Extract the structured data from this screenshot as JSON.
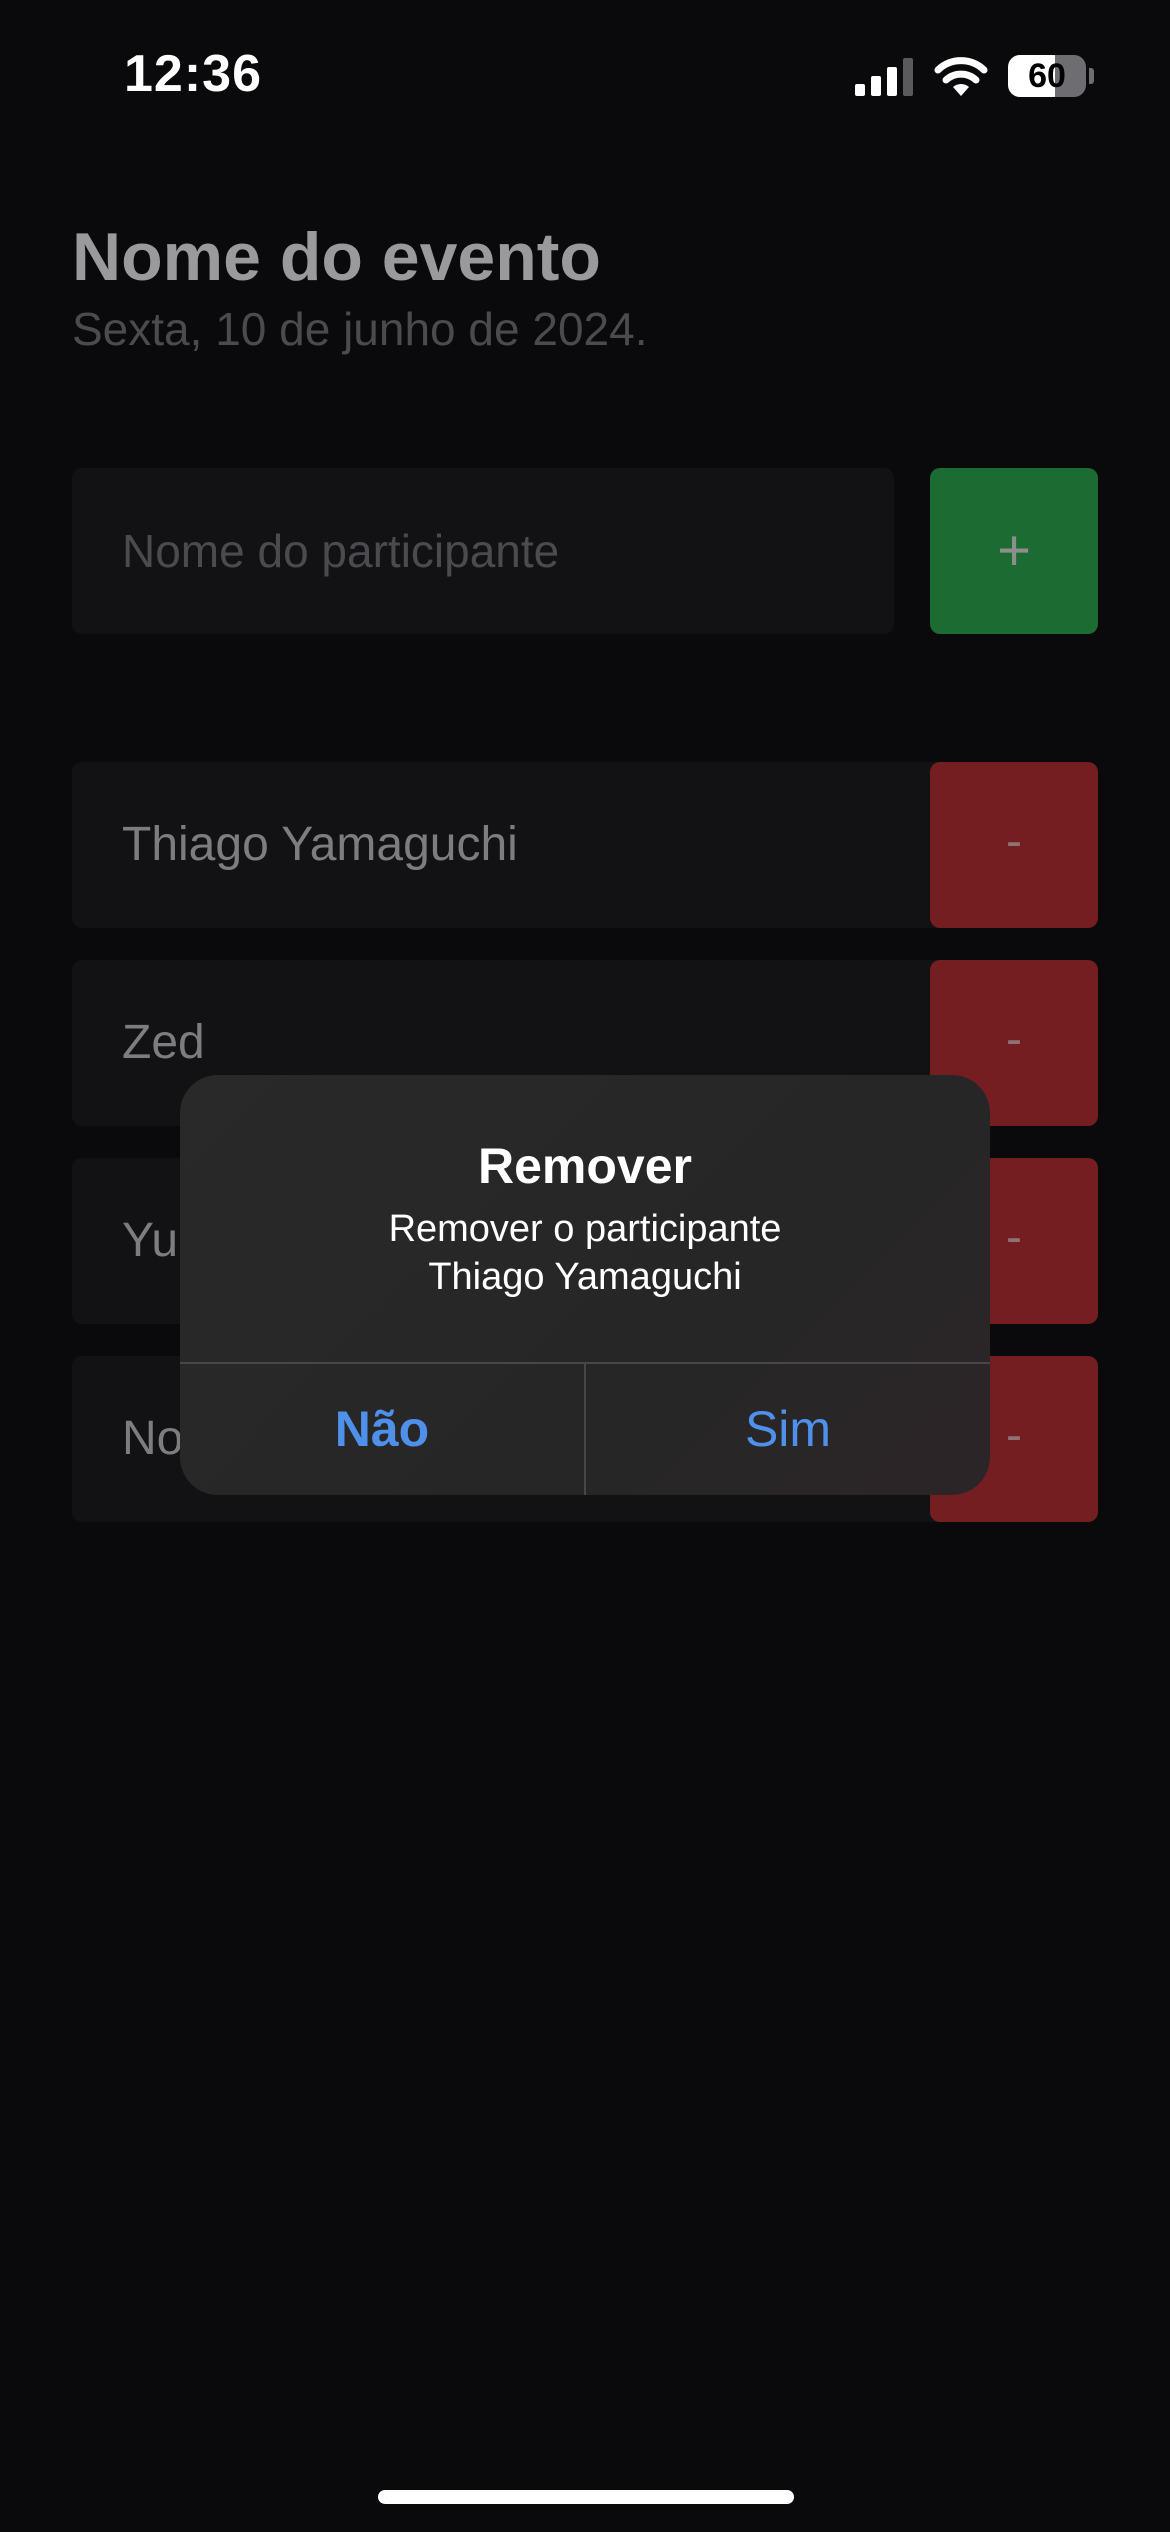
{
  "status_bar": {
    "time": "12:36",
    "battery": "60",
    "icons": [
      "signal-icon",
      "wifi-icon",
      "battery-icon"
    ]
  },
  "event": {
    "title": "Nome do evento",
    "date": "Sexta, 10 de junho de 2024."
  },
  "form": {
    "participant_placeholder": "Nome do participante",
    "participant_value": "",
    "add_label": "+"
  },
  "participants": [
    {
      "name": "Thiago Yamaguchi",
      "remove_label": "-"
    },
    {
      "name": "Zed",
      "remove_label": "-"
    },
    {
      "name": "Yul",
      "remove_label": "-"
    },
    {
      "name": "No",
      "remove_label": "-"
    }
  ],
  "alert": {
    "title": "Remover",
    "message_line1": "Remover o participante",
    "message_line2": "Thiago Yamaguchi",
    "no_label": "Não",
    "yes_label": "Sim"
  },
  "colors": {
    "background": "#0a090c",
    "add_button": "#1b6b32",
    "remove_button": "#751e22",
    "alert_action": "#4f91ea"
  }
}
